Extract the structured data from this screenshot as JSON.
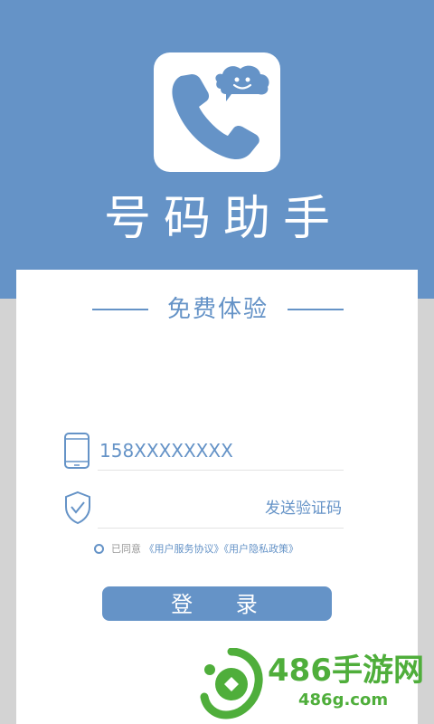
{
  "app": {
    "name": "号码助手",
    "icon": "phone-with-chat-bubble-icon"
  },
  "login_card": {
    "section_title": "免费体验",
    "phone_field": {
      "icon": "mobile-phone-icon",
      "value": "158XXXXXXXX"
    },
    "code_field": {
      "icon": "shield-check-icon",
      "placeholder": "",
      "send_code_label": "发送验证码"
    },
    "agreement": {
      "prefix": "已同意",
      "terms_link": "《用户服务协议》",
      "privacy_link": "《用户隐私政策》"
    },
    "login_label": "登 录"
  },
  "watermark": {
    "text": "486手游网",
    "url": "486g.com"
  },
  "colors": {
    "primary": "#6593c7",
    "background_gray": "#d3d3d3",
    "watermark_green": "#4fae3b"
  }
}
